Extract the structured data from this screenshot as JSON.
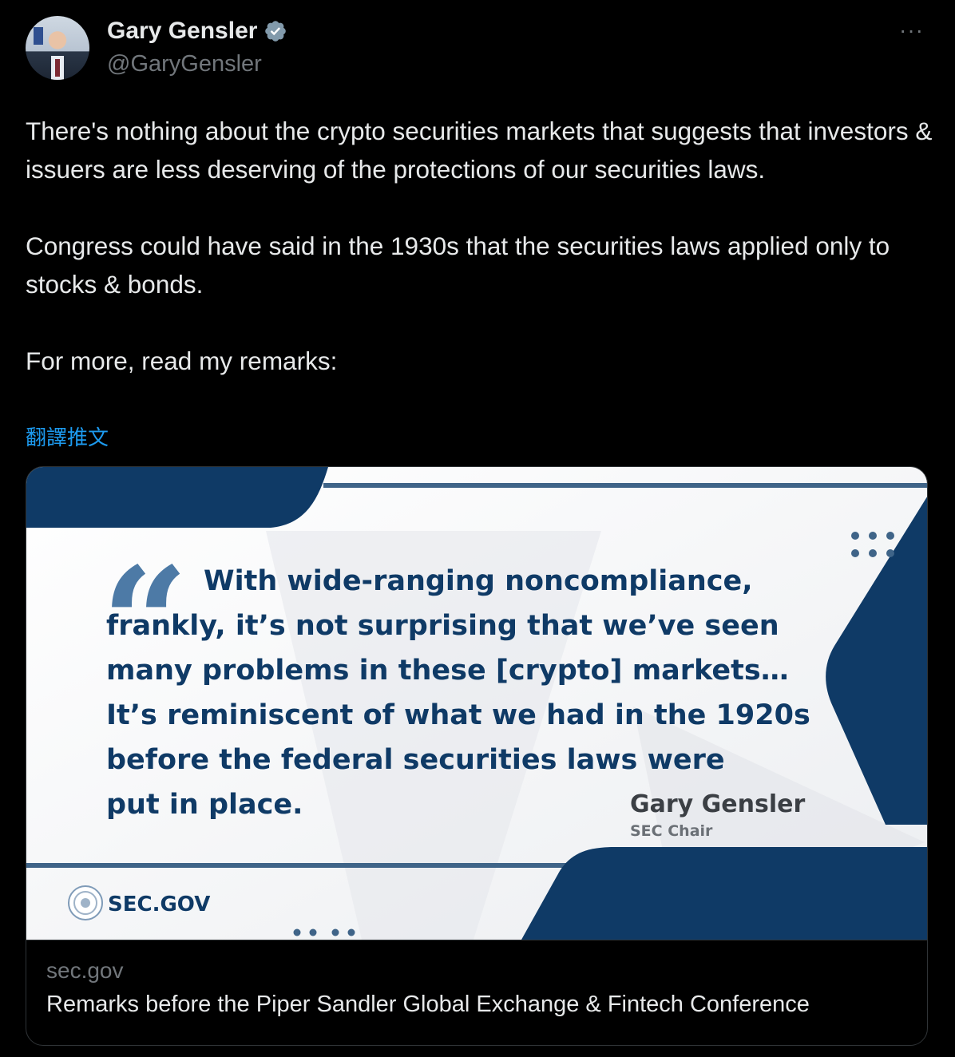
{
  "author": {
    "name": "Gary Gensler",
    "handle": "@GaryGensler",
    "verified": true
  },
  "menu": {
    "more_label": "···"
  },
  "tweet": {
    "paragraphs": [
      "There's nothing about the crypto securities markets that suggests that investors & issuers are less deserving of the protections of our securities laws.",
      "Congress could have said in the 1930s that the securities laws applied only to stocks & bonds.",
      "For more, read my remarks:"
    ],
    "translate_label": "翻譯推文"
  },
  "card": {
    "image": {
      "quote_lines": [
        "With wide-ranging noncompliance,",
        "frankly, it’s not surprising that we’ve seen",
        "many problems in these [crypto] markets…",
        "It’s reminiscent of what we had in the 1920s",
        "before the federal securities laws were",
        "put in place."
      ],
      "attribution_name": "Gary Gensler",
      "attribution_role": "SEC Chair",
      "logo_text": "SEC.GOV",
      "colors": {
        "navy": "#0f3a66",
        "quote_mark": "#4d7aa6",
        "background": "#f2f3f5"
      }
    },
    "domain": "sec.gov",
    "title": "Remarks before the Piper Sandler Global Exchange & Fintech Conference"
  },
  "icons": [
    "verified-badge-icon",
    "more-options-icon",
    "sec-seal-icon",
    "quote-mark-icon"
  ]
}
